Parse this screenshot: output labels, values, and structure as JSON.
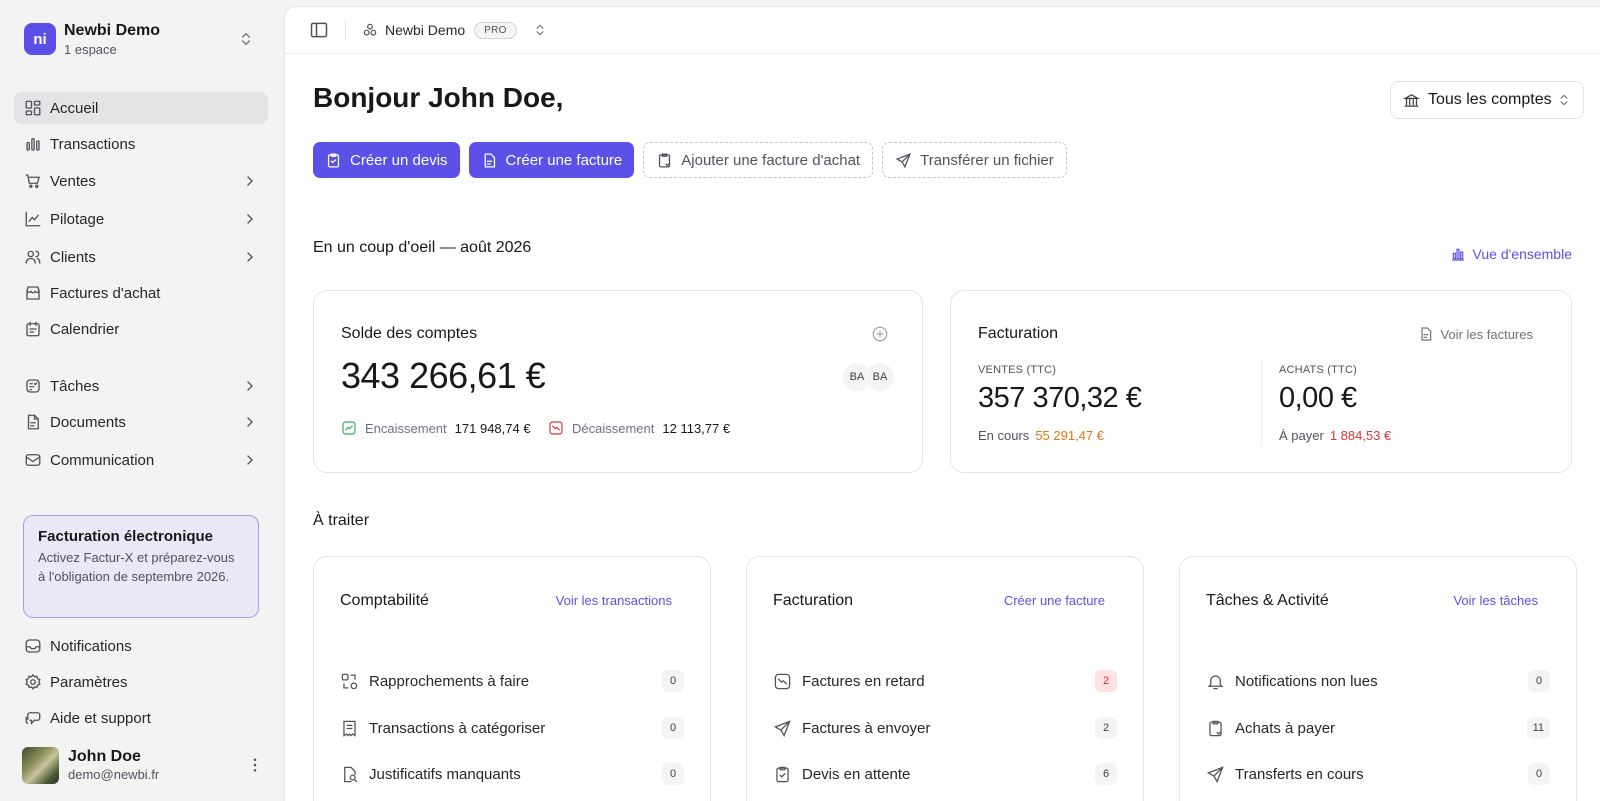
{
  "workspace": {
    "name": "Newbi Demo",
    "subtitle": "1 espace",
    "logo_text": "ni"
  },
  "sidebar": {
    "items": [
      {
        "label": "Accueil",
        "icon": "grid-icon",
        "active": true
      },
      {
        "label": "Transactions",
        "icon": "bar-chart-icon"
      },
      {
        "label": "Ventes",
        "icon": "cart-icon",
        "has_children": true
      },
      {
        "label": "Pilotage",
        "icon": "line-chart-icon",
        "has_children": true
      },
      {
        "label": "Clients",
        "icon": "users-icon",
        "has_children": true
      },
      {
        "label": "Factures d'achat",
        "icon": "store-icon"
      },
      {
        "label": "Calendrier",
        "icon": "calendar-icon"
      },
      {
        "label": "Tâches",
        "icon": "tasks-icon",
        "has_children": true
      },
      {
        "label": "Documents",
        "icon": "document-icon",
        "has_children": true
      },
      {
        "label": "Communication",
        "icon": "mail-icon",
        "has_children": true
      }
    ],
    "promo": {
      "title": "Facturation électronique",
      "text": "Activez Factur-X et préparez-vous à l'obligation de septembre 2026."
    },
    "bottom_items": [
      {
        "label": "Notifications",
        "icon": "inbox-icon"
      },
      {
        "label": "Paramètres",
        "icon": "gear-icon"
      },
      {
        "label": "Aide et support",
        "icon": "help-icon"
      }
    ],
    "user": {
      "name": "John Doe",
      "email": "demo@newbi.fr"
    }
  },
  "topbar": {
    "workspace_name": "Newbi Demo",
    "plan_badge": "PRO"
  },
  "main": {
    "greeting": "Bonjour John Doe,",
    "account_select": "Tous les comptes",
    "actions": {
      "create_quote": "Créer un devis",
      "create_invoice": "Créer une facture",
      "add_purchase_invoice": "Ajouter une facture d'achat",
      "transfer_file": "Transférer un fichier"
    },
    "glance_title": "En un coup d'oeil — août 2026",
    "overview_link": "Vue d'ensemble",
    "balance_card": {
      "title": "Solde des comptes",
      "amount": "343 266,61 €",
      "banks": [
        "BA",
        "BA"
      ],
      "income_label": "Encaissement",
      "income_value": "171 948,74 €",
      "expense_label": "Décaissement",
      "expense_value": "12 113,77 €"
    },
    "billing_card": {
      "title": "Facturation",
      "link": "Voir les factures",
      "sales_label": "VENTES (TTC)",
      "sales_amount": "357 370,32 €",
      "sales_pending_label": "En cours",
      "sales_pending_value": "55 291,47 €",
      "purchases_label": "ACHATS (TTC)",
      "purchases_amount": "0,00 €",
      "purchases_due_label": "À payer",
      "purchases_due_value": "1 884,53 €"
    },
    "todo_title": "À traiter",
    "todo_cards": [
      {
        "title": "Comptabilité",
        "link": "Voir les transactions",
        "rows": [
          {
            "label": "Rapprochements à faire",
            "count": "0",
            "icon": "reconcile-icon"
          },
          {
            "label": "Transactions à catégoriser",
            "count": "0",
            "icon": "receipt-icon"
          },
          {
            "label": "Justificatifs manquants",
            "count": "0",
            "icon": "file-search-icon"
          }
        ]
      },
      {
        "title": "Facturation",
        "link": "Créer une facture",
        "rows": [
          {
            "label": "Factures en retard",
            "count": "2",
            "icon": "overdue-icon",
            "alert": true
          },
          {
            "label": "Factures à envoyer",
            "count": "2",
            "icon": "send-icon"
          },
          {
            "label": "Devis en attente",
            "count": "6",
            "icon": "clipboard-check-icon"
          }
        ]
      },
      {
        "title": "Tâches & Activité",
        "link": "Voir les tâches",
        "rows": [
          {
            "label": "Notifications non lues",
            "count": "0",
            "icon": "bell-icon"
          },
          {
            "label": "Achats à payer",
            "count": "11",
            "icon": "clipboard-icon"
          },
          {
            "label": "Transferts en cours",
            "count": "0",
            "icon": "send-icon"
          }
        ]
      }
    ]
  },
  "colors": {
    "accent": "#5b50e8",
    "warning": "#e07a10",
    "danger": "#e0323c",
    "success": "#2fae62"
  }
}
